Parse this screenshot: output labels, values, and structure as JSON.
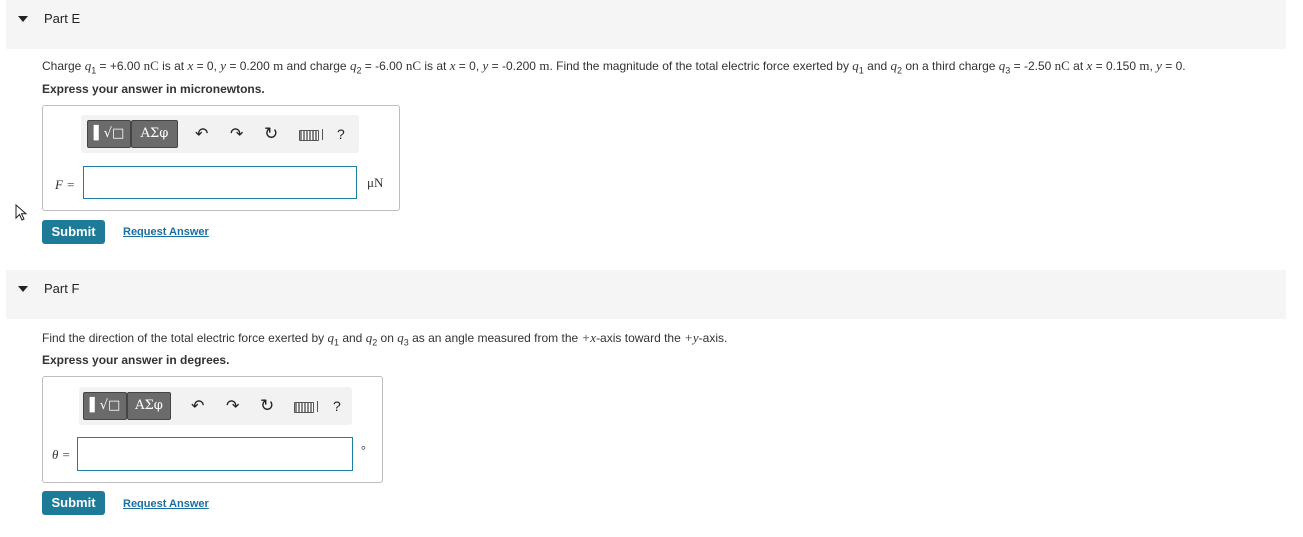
{
  "partE": {
    "title": "Part E",
    "question": {
      "t1": "Charge ",
      "q1": "q",
      "q1sub": "1",
      "t2": " = +6.00 ",
      "u1": "nC",
      "t3": " is at ",
      "x1": "x",
      "t4": " = 0, ",
      "y1": "y",
      "t5": " = 0.200 ",
      "u2": "m",
      "t6": " and charge ",
      "q2": "q",
      "q2sub": "2",
      "t7": " = -6.00 ",
      "u3": "nC",
      "t8": " is at ",
      "x2": "x",
      "t9": " = 0, ",
      "y2": "y",
      "t10": " = -0.200 ",
      "u4": "m",
      "t11": ". Find the magnitude of the total electric force exerted by ",
      "q3": "q",
      "q3sub": "1",
      "t12": " and ",
      "q4": "q",
      "q4sub": "2",
      "t13": " on a third charge ",
      "q5": "q",
      "q5sub": "3",
      "t14": " = -2.50 ",
      "u5": "nC",
      "t15": " at ",
      "x3": "x",
      "t16": " = 0.150 ",
      "u6": "m",
      "t17": ", ",
      "y3": "y",
      "t18": " = 0."
    },
    "instruction": "Express your answer in micronewtons.",
    "toolbar": {
      "templates_label": "▌√□",
      "symbols_label": "ΑΣφ",
      "help_label": "?"
    },
    "variable_label": "F =",
    "input_value": "",
    "unit": "μN",
    "submit_label": "Submit",
    "request_label": "Request Answer"
  },
  "partF": {
    "title": "Part F",
    "question": {
      "t1": "Find the direction of the total electric force exerted by ",
      "q1": "q",
      "q1sub": "1",
      "t2": " and ",
      "q2": "q",
      "q2sub": "2",
      "t3": " on ",
      "q3": "q",
      "q3sub": "3",
      "t4": " as an angle measured from the ",
      "ax1": "+x",
      "t5": "-axis toward the ",
      "ax2": "+y",
      "t6": "-axis."
    },
    "instruction": "Express your answer in degrees.",
    "toolbar": {
      "templates_label": "▌√□",
      "symbols_label": "ΑΣφ",
      "help_label": "?"
    },
    "variable_label": "θ =",
    "input_value": "",
    "unit": "°",
    "submit_label": "Submit",
    "request_label": "Request Answer"
  }
}
